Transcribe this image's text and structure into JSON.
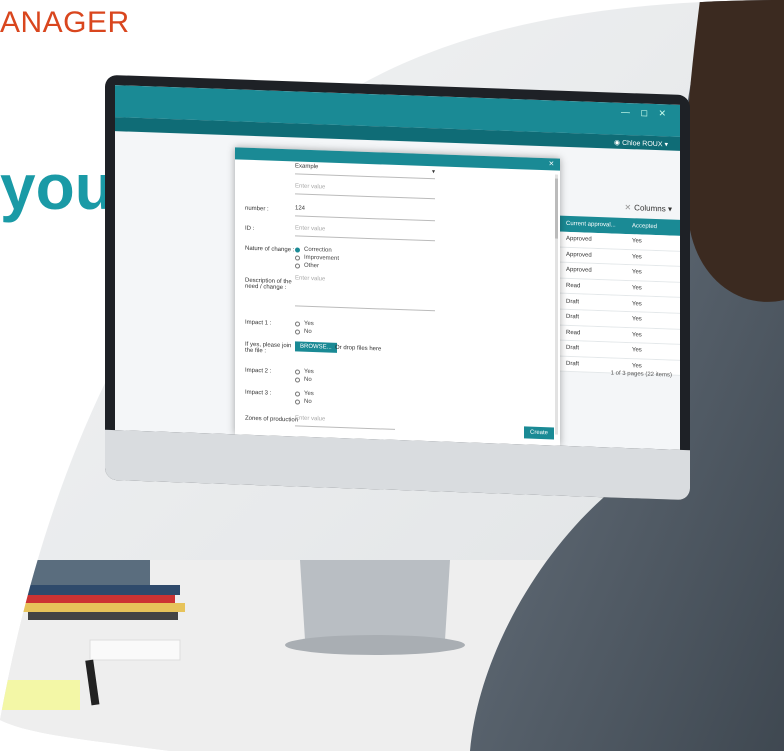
{
  "headline": {
    "brand": "ANAGER",
    "big": "your"
  },
  "colors": {
    "accent": "#1a8a95",
    "brand": "#d9461e",
    "headline": "#1a9aa6"
  },
  "app": {
    "user_chip": "Chloe ROUX",
    "columns_label": "Columns",
    "table": {
      "headers": [
        "Current approval...",
        "Accepted"
      ],
      "rows": [
        [
          "Approved",
          "Yes"
        ],
        [
          "Approved",
          "Yes"
        ],
        [
          "Approved",
          "Yes"
        ],
        [
          "Read",
          "Yes"
        ],
        [
          "Draft",
          "Yes"
        ],
        [
          "Draft",
          "Yes"
        ],
        [
          "Read",
          "Yes"
        ],
        [
          "Draft",
          "Yes"
        ],
        [
          "Draft",
          "Yes"
        ]
      ],
      "pager": "1 of 3 pages (22 items)"
    },
    "modal": {
      "select_value": "Example",
      "field1_placeholder": "Enter value",
      "number_label": "number :",
      "number_value": "124",
      "id_label": "ID :",
      "id_placeholder": "Enter value",
      "nature_label": "Nature of change :",
      "nature_options": [
        "Correction",
        "Improvement",
        "Other"
      ],
      "description_label": "Description of the need / change :",
      "description_placeholder": "Enter value",
      "impact1_label": "Impact 1 :",
      "impact2_label": "Impact 2 :",
      "impact3_label": "Impact 3 :",
      "yes": "Yes",
      "no": "No",
      "file_label": "If yes, please join the file :",
      "browse_label": "BROWSE...",
      "drop_label": "Or drop files here",
      "zones_label": "Zones of production",
      "zones_placeholder": "Enter value",
      "create_label": "Create",
      "close": "×"
    }
  }
}
